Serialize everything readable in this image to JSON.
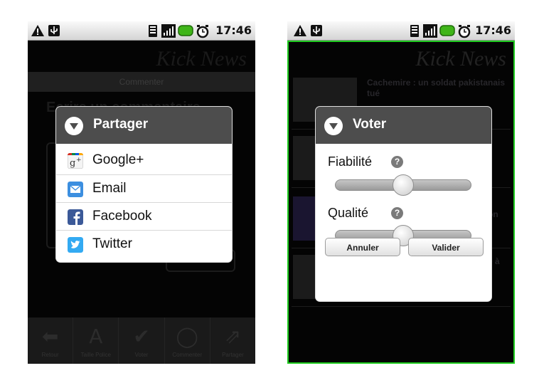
{
  "status_bar": {
    "time": "17:46",
    "icons": [
      "warning-icon",
      "usb-icon",
      "sd-card-icon",
      "signal-icon",
      "battery-icon",
      "alarm-icon"
    ]
  },
  "app": {
    "brand": "Kick News",
    "subbar_label": "Commenter",
    "comment_title": "Ecrire un commentaire"
  },
  "share_dialog": {
    "title": "Partager",
    "items": [
      {
        "label": "Google+",
        "icon": "google-plus-icon",
        "color": "#ffffff"
      },
      {
        "label": "Email",
        "icon": "email-icon",
        "color": "#3c8fe0"
      },
      {
        "label": "Facebook",
        "icon": "facebook-icon",
        "color": "#3b5998"
      },
      {
        "label": "Twitter",
        "icon": "twitter-icon",
        "color": "#33aaf2"
      }
    ]
  },
  "bottom_nav": [
    {
      "label": "Retour",
      "icon": "back-arrow-icon"
    },
    {
      "label": "Taille Police",
      "icon": "font-size-icon"
    },
    {
      "label": "Voter",
      "icon": "check-icon"
    },
    {
      "label": "Commenter",
      "icon": "speech-bubble-icon"
    },
    {
      "label": "Partager",
      "icon": "share-icon"
    }
  ],
  "news_list": [
    {
      "title": "Cachemire : un soldat pakistanais tué"
    },
    {
      "title": ""
    },
    {
      "title": "on"
    },
    {
      "title": "e à"
    }
  ],
  "vote_dialog": {
    "title": "Voter",
    "sliders": [
      {
        "label": "Fiabilité",
        "help": "?",
        "value_fraction": 0.5
      },
      {
        "label": "Qualité",
        "help": "?",
        "value_fraction": 0.5
      }
    ],
    "cancel_label": "Annuler",
    "confirm_label": "Valider"
  },
  "colors": {
    "dialog_header": "#4d4d4d",
    "focus_frame": "#1ecb1e",
    "backdrop": "#111111"
  }
}
